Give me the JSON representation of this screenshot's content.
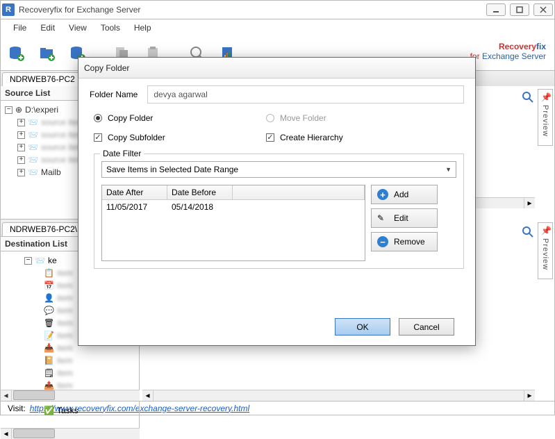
{
  "window": {
    "title": "Recoveryfix for Exchange Server"
  },
  "menus": {
    "file": "File",
    "edit": "Edit",
    "view": "View",
    "tools": "Tools",
    "help": "Help"
  },
  "brand": {
    "prefix": "Recovery",
    "suffix": "fix",
    "sub_prefix": "for ",
    "sub_suffix": "Exchange Server"
  },
  "top_tab": {
    "label": "NDRWEB76-PC2"
  },
  "source": {
    "header": "Source List",
    "root_prefix": "D:\\experi",
    "item_mailbox": "Mailb"
  },
  "mid_tab": {
    "label": "NDRWEB76-PC2\\"
  },
  "destination": {
    "header": "Destination List",
    "root": "ke",
    "items": {
      "sent": "Sent Items",
      "tasks": "Tasks"
    }
  },
  "preview": {
    "label": "Preview"
  },
  "status": {
    "prefix": "Visit:",
    "url": "https://www.recoveryfix.com/exchange-server-recovery.html"
  },
  "dialog": {
    "title": "Copy Folder",
    "folder_name_label": "Folder Name",
    "folder_name_value": "devya agarwal",
    "copy_folder": "Copy Folder",
    "move_folder": "Move Folder",
    "copy_subfolder": "Copy Subfolder",
    "create_hierarchy": "Create Hierarchy",
    "date_filter_legend": "Date Filter",
    "combo_value": "Save Items in Selected Date Range",
    "grid": {
      "col_after": "Date After",
      "col_before": "Date Before",
      "rows": [
        {
          "after": "11/05/2017",
          "before": "05/14/2018"
        }
      ]
    },
    "buttons": {
      "add": "Add",
      "edit": "Edit",
      "remove": "Remove"
    },
    "ok": "OK",
    "cancel": "Cancel"
  }
}
